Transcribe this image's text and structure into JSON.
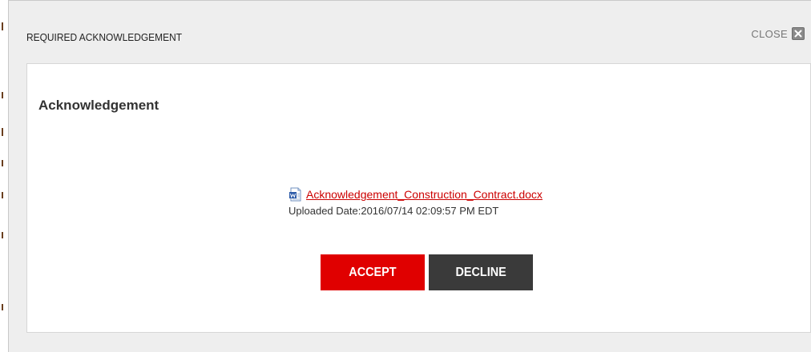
{
  "dialog": {
    "title": "REQUIRED ACKNOWLEDGEMENT",
    "close_label": "CLOSE",
    "close_icon": "close-icon"
  },
  "body": {
    "heading": "Acknowledgement",
    "file": {
      "icon": "word-document-icon",
      "name": "Acknowledgement_Construction_Contract.docx",
      "uploaded_label": "Uploaded Date:",
      "uploaded_value": "2016/07/14 02:09:57 PM EDT"
    },
    "accept_label": "ACCEPT",
    "decline_label": "DECLINE"
  },
  "colors": {
    "accent": "#e00000",
    "link": "#cc0000",
    "dark_button": "#3a3a3a",
    "overlay": "#eeeeee"
  }
}
